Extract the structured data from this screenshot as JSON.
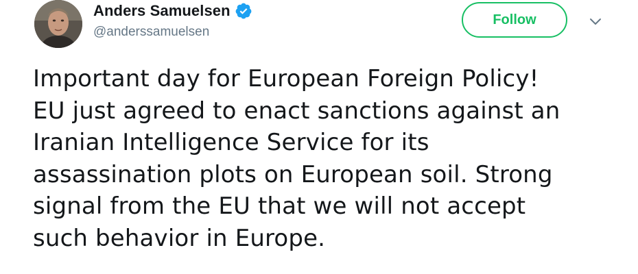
{
  "author": {
    "display_name": "Anders Samuelsen",
    "handle": "@anderssamuelsen",
    "verified": true,
    "avatar_icon": "person-photo-icon"
  },
  "actions": {
    "follow_label": "Follow",
    "menu_icon": "chevron-down-icon",
    "follow_color": "#17bf63"
  },
  "tweet": {
    "text": "Important day for European Foreign Policy!\nEU just agreed to enact sanctions against an\nIranian Intelligence Service for its\nassassination plots on European soil. Strong\nsignal from the EU that we will not accept\nsuch behavior in Europe."
  },
  "colors": {
    "text": "#14171a",
    "secondary": "#657786",
    "verified_badge": "#1da1f2"
  }
}
